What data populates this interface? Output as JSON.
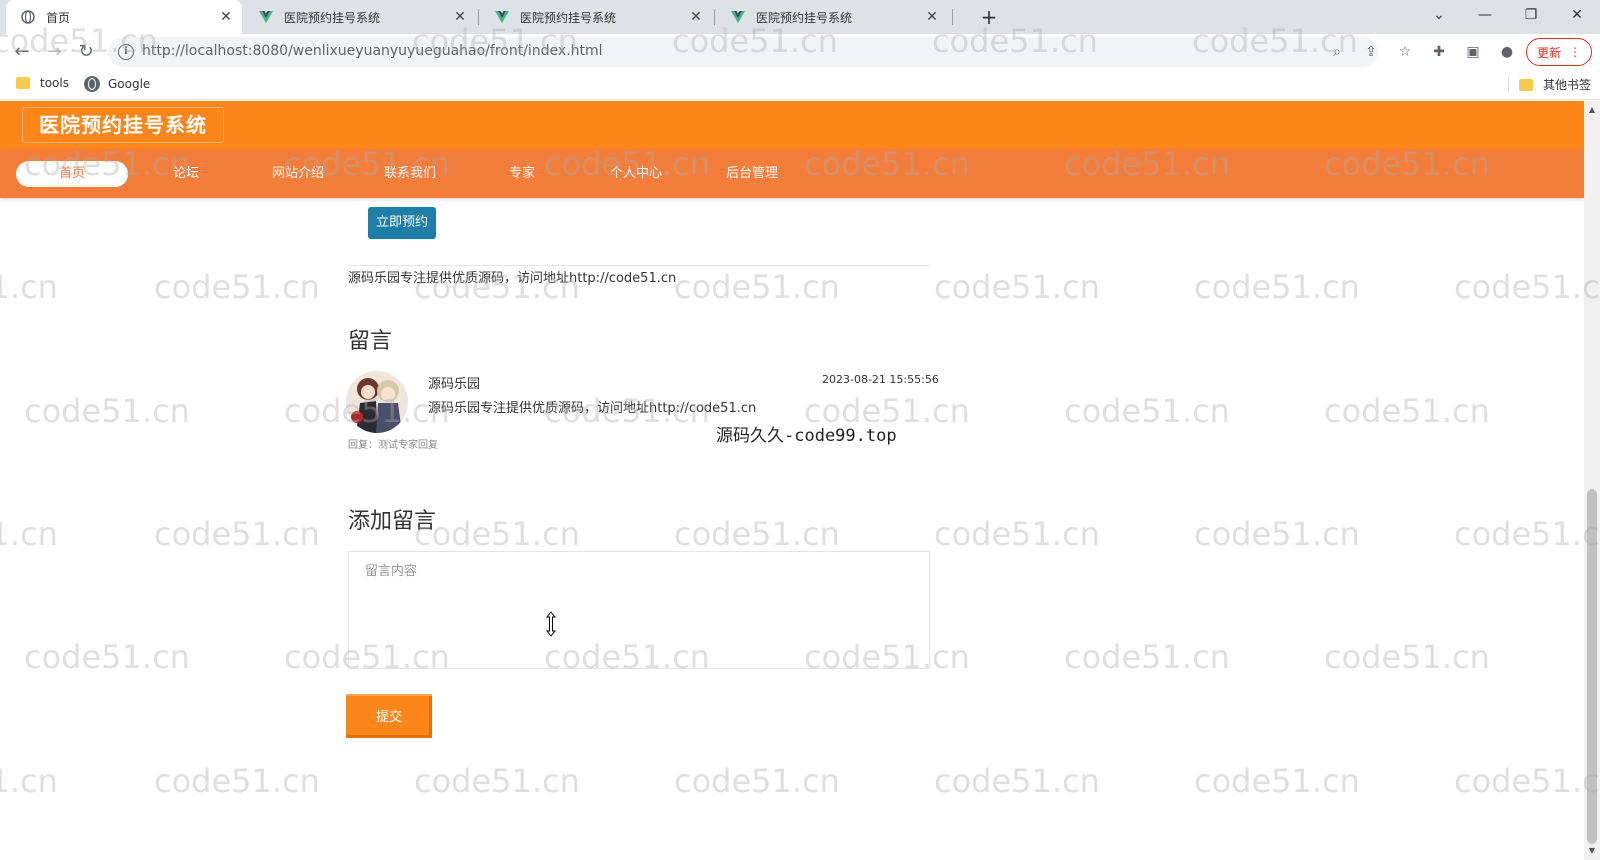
{
  "browser": {
    "tabs": [
      {
        "title": "首页",
        "active": true
      },
      {
        "title": "医院预约挂号系统",
        "active": false
      },
      {
        "title": "医院预约挂号系统",
        "active": false
      },
      {
        "title": "医院预约挂号系统",
        "active": false
      }
    ],
    "url": "http://localhost:8080/wenlixueyuanyuyueguahao/front/index.html",
    "update_label": "更新",
    "bookmarks": [
      {
        "label": "tools",
        "icon": "folder-icon"
      },
      {
        "label": "Google",
        "icon": "globe-icon"
      }
    ],
    "other_bookmarks": "其他书签"
  },
  "site": {
    "logo": "医院预约挂号系统",
    "brand_color": "#fc8619",
    "nav_color": "#f37d3a",
    "nav": [
      "首页",
      "论坛",
      "网站介绍",
      "联系我们",
      "专家",
      "个人中心",
      "后台管理"
    ],
    "active_nav": "首页"
  },
  "content": {
    "book_button": "立即预约",
    "intro_text": "源码乐园专注提供优质源码，访问地址http://code51.cn",
    "comments_title": "留言",
    "comments": [
      {
        "user": "源码乐园",
        "time": "2023-08-21 15:55:56",
        "text": "源码乐园专注提供优质源码，访问地址http://code51.cn",
        "reply": "回复：测试专家回复"
      }
    ],
    "overlay_text": "源码久久-code99.top",
    "add_comment_title": "添加留言",
    "comment_placeholder": "留言内容",
    "submit_label": "提交"
  },
  "watermark": "code51.cn"
}
